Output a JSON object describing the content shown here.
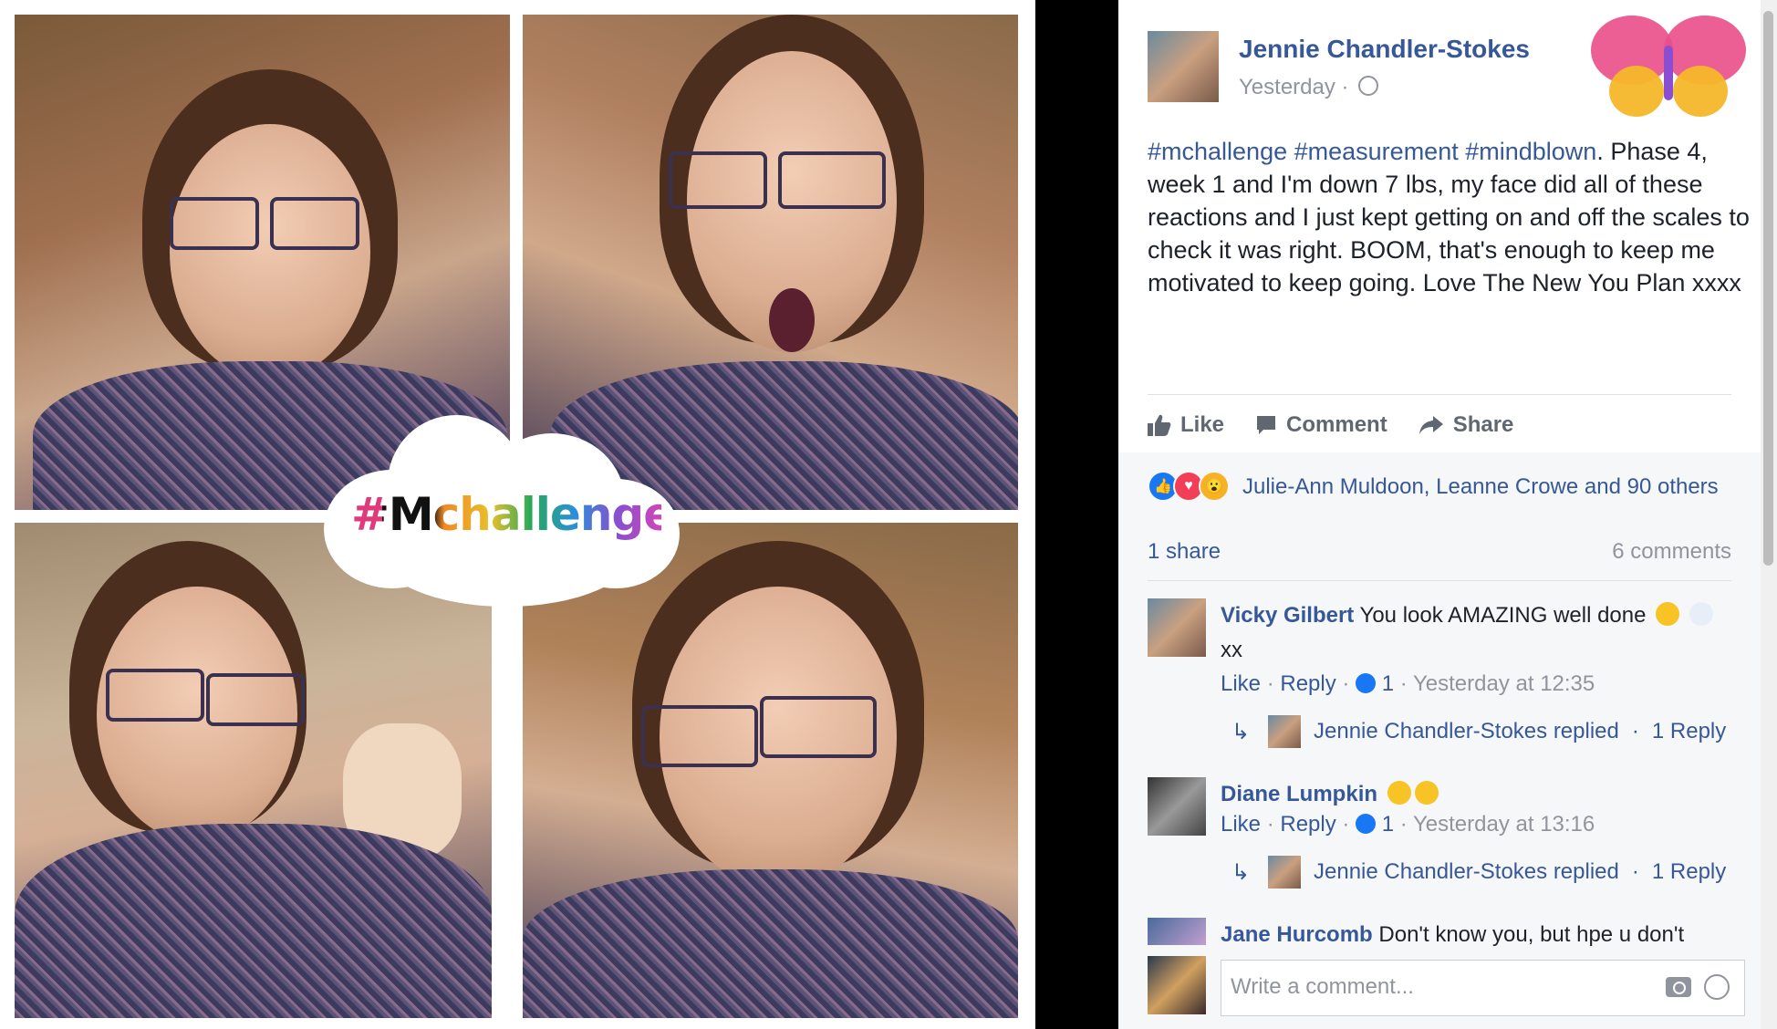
{
  "collage": {
    "overlay_text": "#Mchallenge"
  },
  "post": {
    "author": "Jennie Chandler-Stokes",
    "time": "Yesterday",
    "hashtags": [
      "#mchallenge",
      "#measurement",
      "#mindblown"
    ],
    "text": ". Phase 4, week 1 and I'm down 7 lbs, my face did all of these reactions and I just kept getting on and off the scales to check it was right. BOOM, that's enough to keep me motivated to keep going. Love The New You Plan xxxx"
  },
  "actions": {
    "like": "Like",
    "comment": "Comment",
    "share": "Share"
  },
  "reactions": {
    "icons": [
      "like-icon",
      "love-icon",
      "wow-icon"
    ],
    "summary": "Julie-Ann Muldoon, Leanne Crowe and 90 others"
  },
  "stats": {
    "shares": "1 share",
    "comments": "6 comments"
  },
  "comments": [
    {
      "author": "Vicky Gilbert",
      "text": "You look AMAZING well done",
      "text_cont": "xx",
      "like": "Like",
      "reply": "Reply",
      "likes": "1",
      "time": "Yesterday at 12:35",
      "replied_by": "Jennie Chandler-Stokes replied",
      "replies": "1 Reply"
    },
    {
      "author": "Diane Lumpkin",
      "like": "Like",
      "reply": "Reply",
      "likes": "1",
      "time": "Yesterday at 13:16",
      "replied_by": "Jennie Chandler-Stokes replied",
      "replies": "1 Reply"
    },
    {
      "author": "Jane Hurcomb",
      "text": "Don't know you, but hpe u don't"
    }
  ],
  "composer": {
    "placeholder": "Write a comment..."
  },
  "colors": {
    "link_blue": "#365899",
    "meta_grey": "#90949c",
    "like_blue": "#1877f2"
  }
}
